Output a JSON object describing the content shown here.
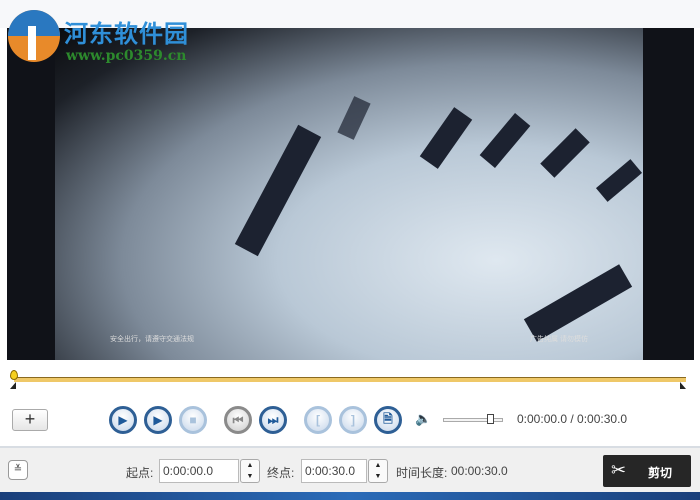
{
  "watermark": {
    "title": "河东软件园",
    "url": "www.pc0359.cn"
  },
  "video": {
    "subtitle_left": "安全出行，请遵守交通法规",
    "subtitle_right": "广告纯属 请勿模仿"
  },
  "timeline": {
    "position": 0
  },
  "controls": {
    "add": "+",
    "time_display": "0:00:00.0 / 0:00:30.0",
    "volume": 0.8
  },
  "bottom": {
    "expand": "≚",
    "start_label": "起点:",
    "start_value": "0:00:00.0",
    "end_label": "终点:",
    "end_value": "0:00:30.0",
    "duration_label": "时间长度:",
    "duration_value": "00:00:30.0",
    "cut_label": "剪切"
  }
}
